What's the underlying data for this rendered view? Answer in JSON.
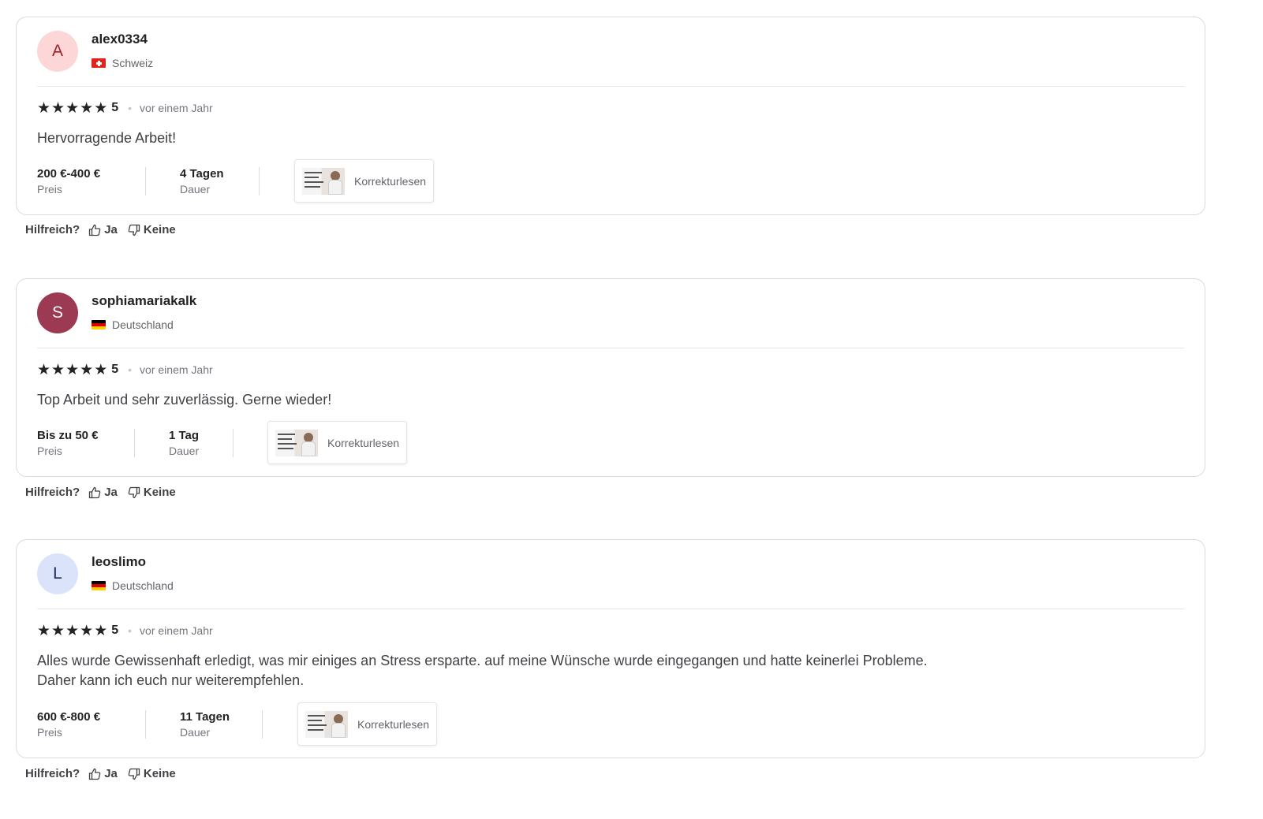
{
  "reviews": [
    {
      "avatar_letter": "A",
      "avatar_bg": "#fdd7d7",
      "avatar_fg": "#9b2226",
      "username": "alex0334",
      "country": "Schweiz",
      "flag": "flag-ch",
      "rating": "5",
      "time": "vor einem Jahr",
      "comment": "Hervorragende Arbeit!",
      "price": "200 €-400 €",
      "price_label": "Preis",
      "duration": "4 Tagen",
      "duration_label": "Dauer",
      "gig_label": "Korrekturlesen",
      "helpful_label": "Hilfreich?",
      "yes_label": "Ja",
      "no_label": "Keine"
    },
    {
      "avatar_letter": "S",
      "avatar_bg": "#9c3a54",
      "avatar_fg": "#ffffff",
      "username": "sophiamariakalk",
      "country": "Deutschland",
      "flag": "flag-de",
      "rating": "5",
      "time": "vor einem Jahr",
      "comment": "Top Arbeit und sehr zuverlässig. Gerne wieder!",
      "price": "Bis zu 50 €",
      "price_label": "Preis",
      "duration": "1 Tag",
      "duration_label": "Dauer",
      "gig_label": "Korrekturlesen",
      "helpful_label": "Hilfreich?",
      "yes_label": "Ja",
      "no_label": "Keine"
    },
    {
      "avatar_letter": "L",
      "avatar_bg": "#dbe3fb",
      "avatar_fg": "#1e2a5a",
      "username": "leoslimo",
      "country": "Deutschland",
      "flag": "flag-de",
      "rating": "5",
      "time": "vor einem Jahr",
      "comment_line1": "Alles wurde Gewissenhaft erledigt, was mir einiges an Stress ersparte. auf meine Wünsche wurde eingegangen und hatte keinerlei Probleme.",
      "comment_line2": "Daher kann ich euch nur weiterempfehlen.",
      "price": "600 €-800 €",
      "price_label": "Preis",
      "duration": "11 Tagen",
      "duration_label": "Dauer",
      "gig_label": "Korrekturlesen",
      "helpful_label": "Hilfreich?",
      "yes_label": "Ja",
      "no_label": "Keine"
    }
  ],
  "icons": {
    "star": "star-icon",
    "thumbs_up": "thumbs-up-icon",
    "thumbs_down": "thumbs-down-icon"
  }
}
